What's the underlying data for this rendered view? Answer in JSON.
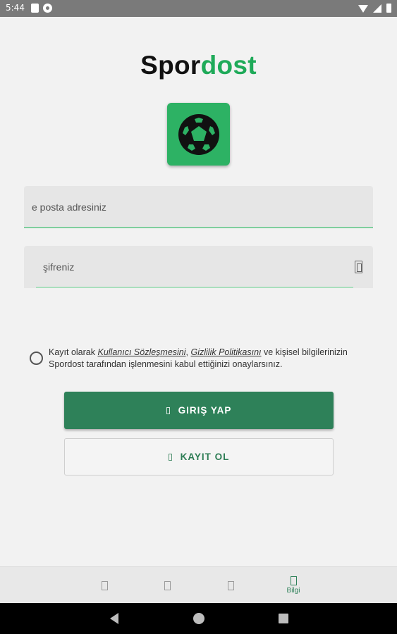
{
  "status_bar": {
    "time": "5:44"
  },
  "logo": {
    "part1": "Spor",
    "part2": "dost"
  },
  "app_icon": {
    "icon": "soccer-ball-icon",
    "color": "#2db264"
  },
  "form": {
    "email_placeholder": "e posta adresiniz",
    "password_placeholder": "şifreniz"
  },
  "consent": {
    "prefix": "Kayıt olarak ",
    "terms_link": "Kullanıcı Sözleşmesini",
    "sep": ", ",
    "privacy_link": "Gizlilik Politikasını",
    "suffix": " ve kişisel bilgilerinizin Spordost tarafından işlenmesini kabul ettiğinizi onaylarsınız."
  },
  "buttons": {
    "login": "GIRIŞ YAP",
    "register": "KAYIT OL"
  },
  "bottom_tabs": [
    {
      "label": ""
    },
    {
      "label": ""
    },
    {
      "label": ""
    },
    {
      "label": "Bilgi"
    }
  ],
  "colors": {
    "brand_green": "#1faa59",
    "button_green": "#2e8159"
  }
}
